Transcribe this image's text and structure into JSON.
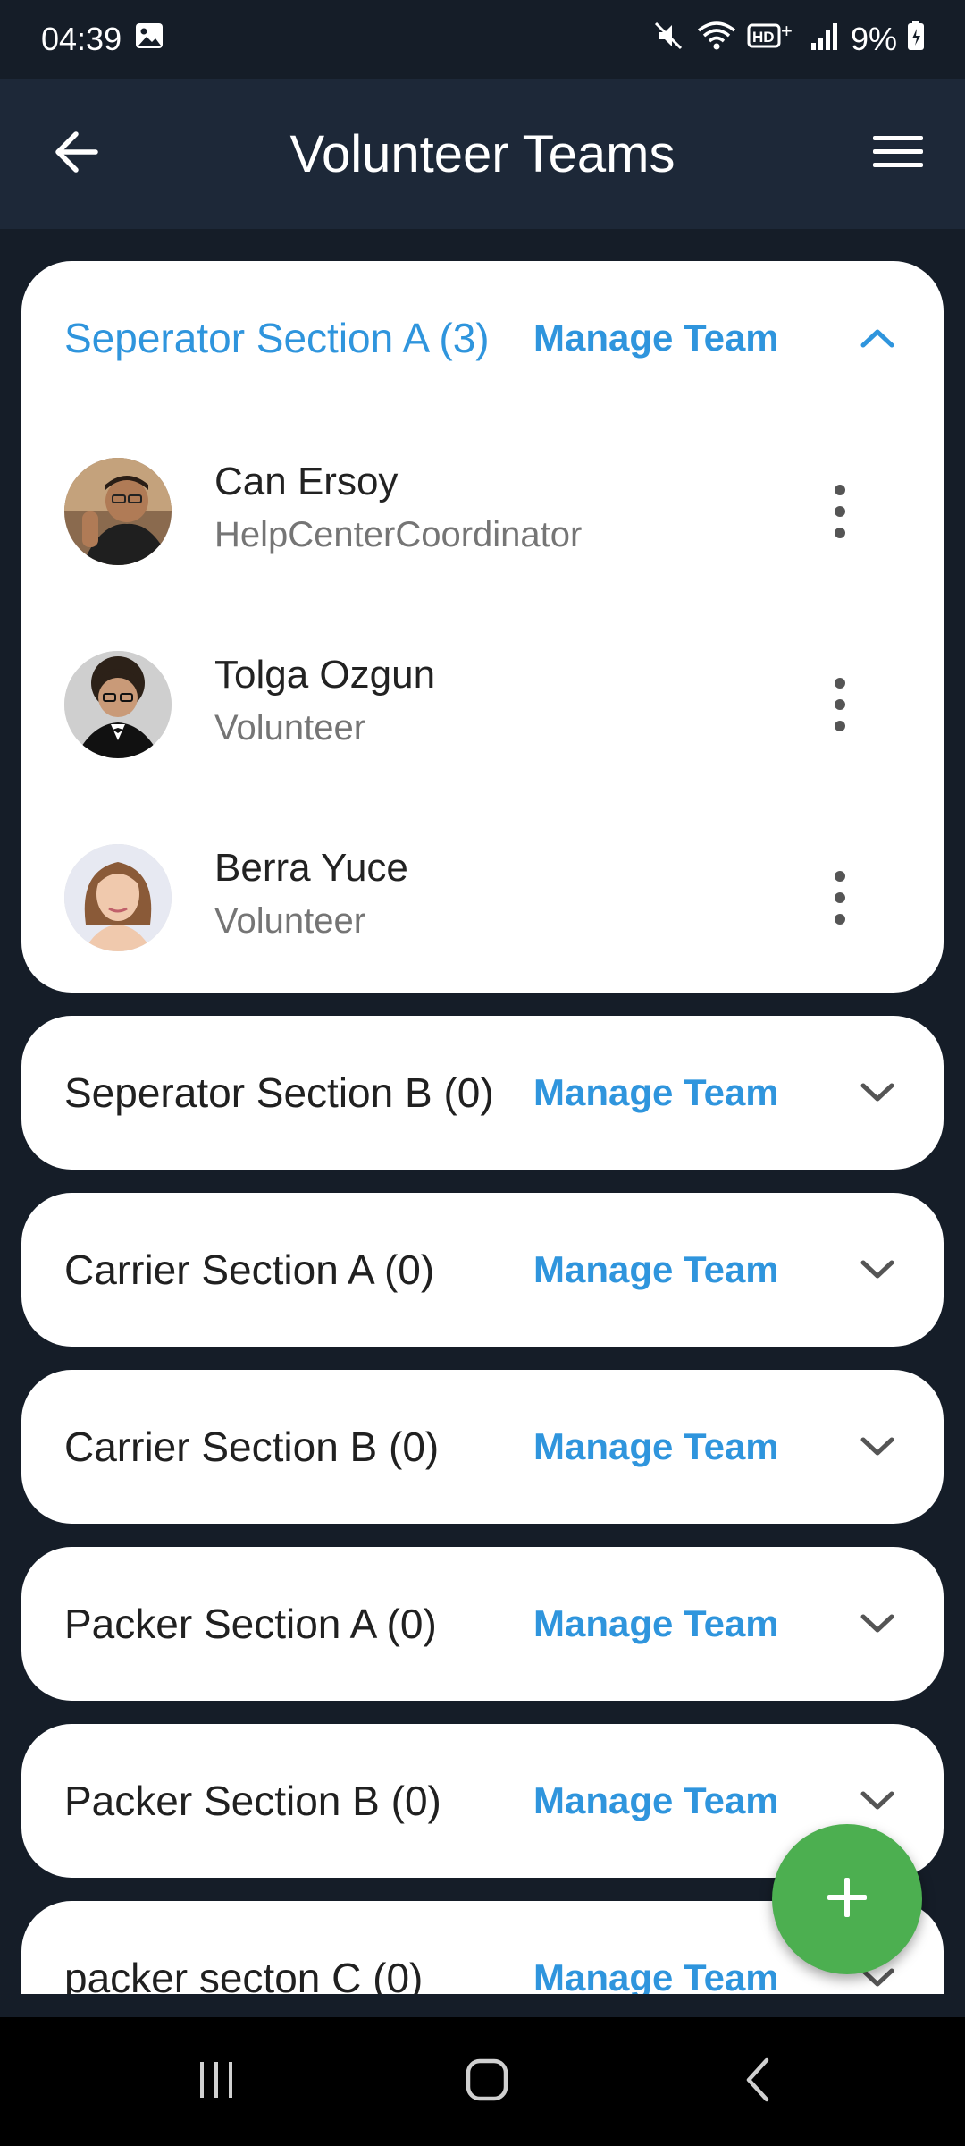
{
  "status_bar": {
    "time": "04:39",
    "battery": "9%",
    "icons": [
      "gallery-icon",
      "mute-icon",
      "wifi-icon",
      "hd-plus-icon",
      "signal-icon",
      "battery-charging-icon"
    ]
  },
  "app_bar": {
    "title": "Volunteer Teams",
    "back_icon": "arrow-left-icon",
    "menu_icon": "hamburger-menu-icon"
  },
  "teams": [
    {
      "name": "Seperator Section A (3)",
      "manage_label": "Manage Team",
      "expanded": true,
      "members": [
        {
          "name": "Can Ersoy",
          "role": "HelpCenterCoordinator"
        },
        {
          "name": "Tolga Ozgun",
          "role": "Volunteer"
        },
        {
          "name": "Berra Yuce",
          "role": "Volunteer"
        }
      ]
    },
    {
      "name": "Seperator Section B (0)",
      "manage_label": "Manage Team",
      "expanded": false
    },
    {
      "name": "Carrier Section A (0)",
      "manage_label": "Manage Team",
      "expanded": false
    },
    {
      "name": "Carrier Section B (0)",
      "manage_label": "Manage Team",
      "expanded": false
    },
    {
      "name": "Packer Section A (0)",
      "manage_label": "Manage Team",
      "expanded": false
    },
    {
      "name": "Packer Section B (0)",
      "manage_label": "Manage Team",
      "expanded": false
    },
    {
      "name": "packer secton C (0)",
      "manage_label": "Manage Team",
      "expanded": false
    }
  ],
  "fab": {
    "icon": "plus-icon"
  },
  "colors": {
    "background": "#151d28",
    "app_bar": "#1d2838",
    "accent": "#2f95dd",
    "fab": "#4caf50"
  }
}
